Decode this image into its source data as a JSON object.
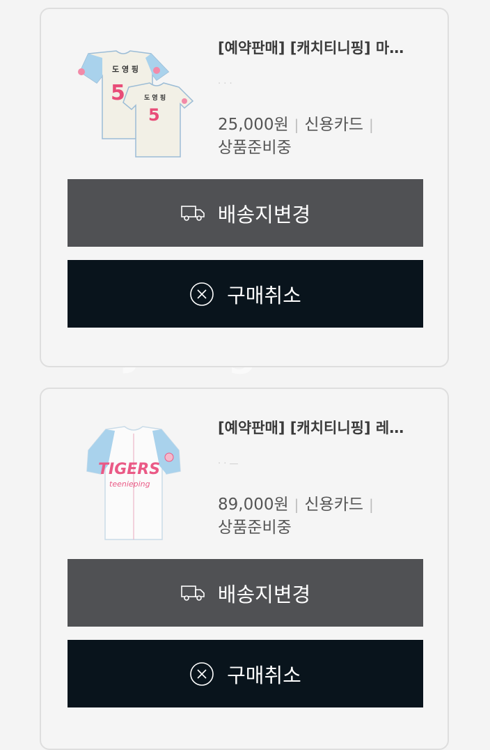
{
  "orders": [
    {
      "title": "[예약판매] [캐치티니핑] 마…",
      "faded_text": "· · ·",
      "price": "25,000원",
      "payment": "신용카드",
      "status": "상품준비중",
      "jersey_name": "도 영 핑",
      "jersey_number": "5",
      "buttons": {
        "ship": "배송지변경",
        "cancel": "구매취소"
      }
    },
    {
      "title": "[예약판매] [캐치티니핑] 레…",
      "faded_text": "·          ·    —",
      "price": "89,000원",
      "payment": "신용카드",
      "status": "상품준비중",
      "jersey_text": "TIGERS",
      "jersey_script": "teenieping",
      "buttons": {
        "ship": "배송지변경",
        "cancel": "구매취소"
      }
    }
  ],
  "watermark": "Joongonara"
}
